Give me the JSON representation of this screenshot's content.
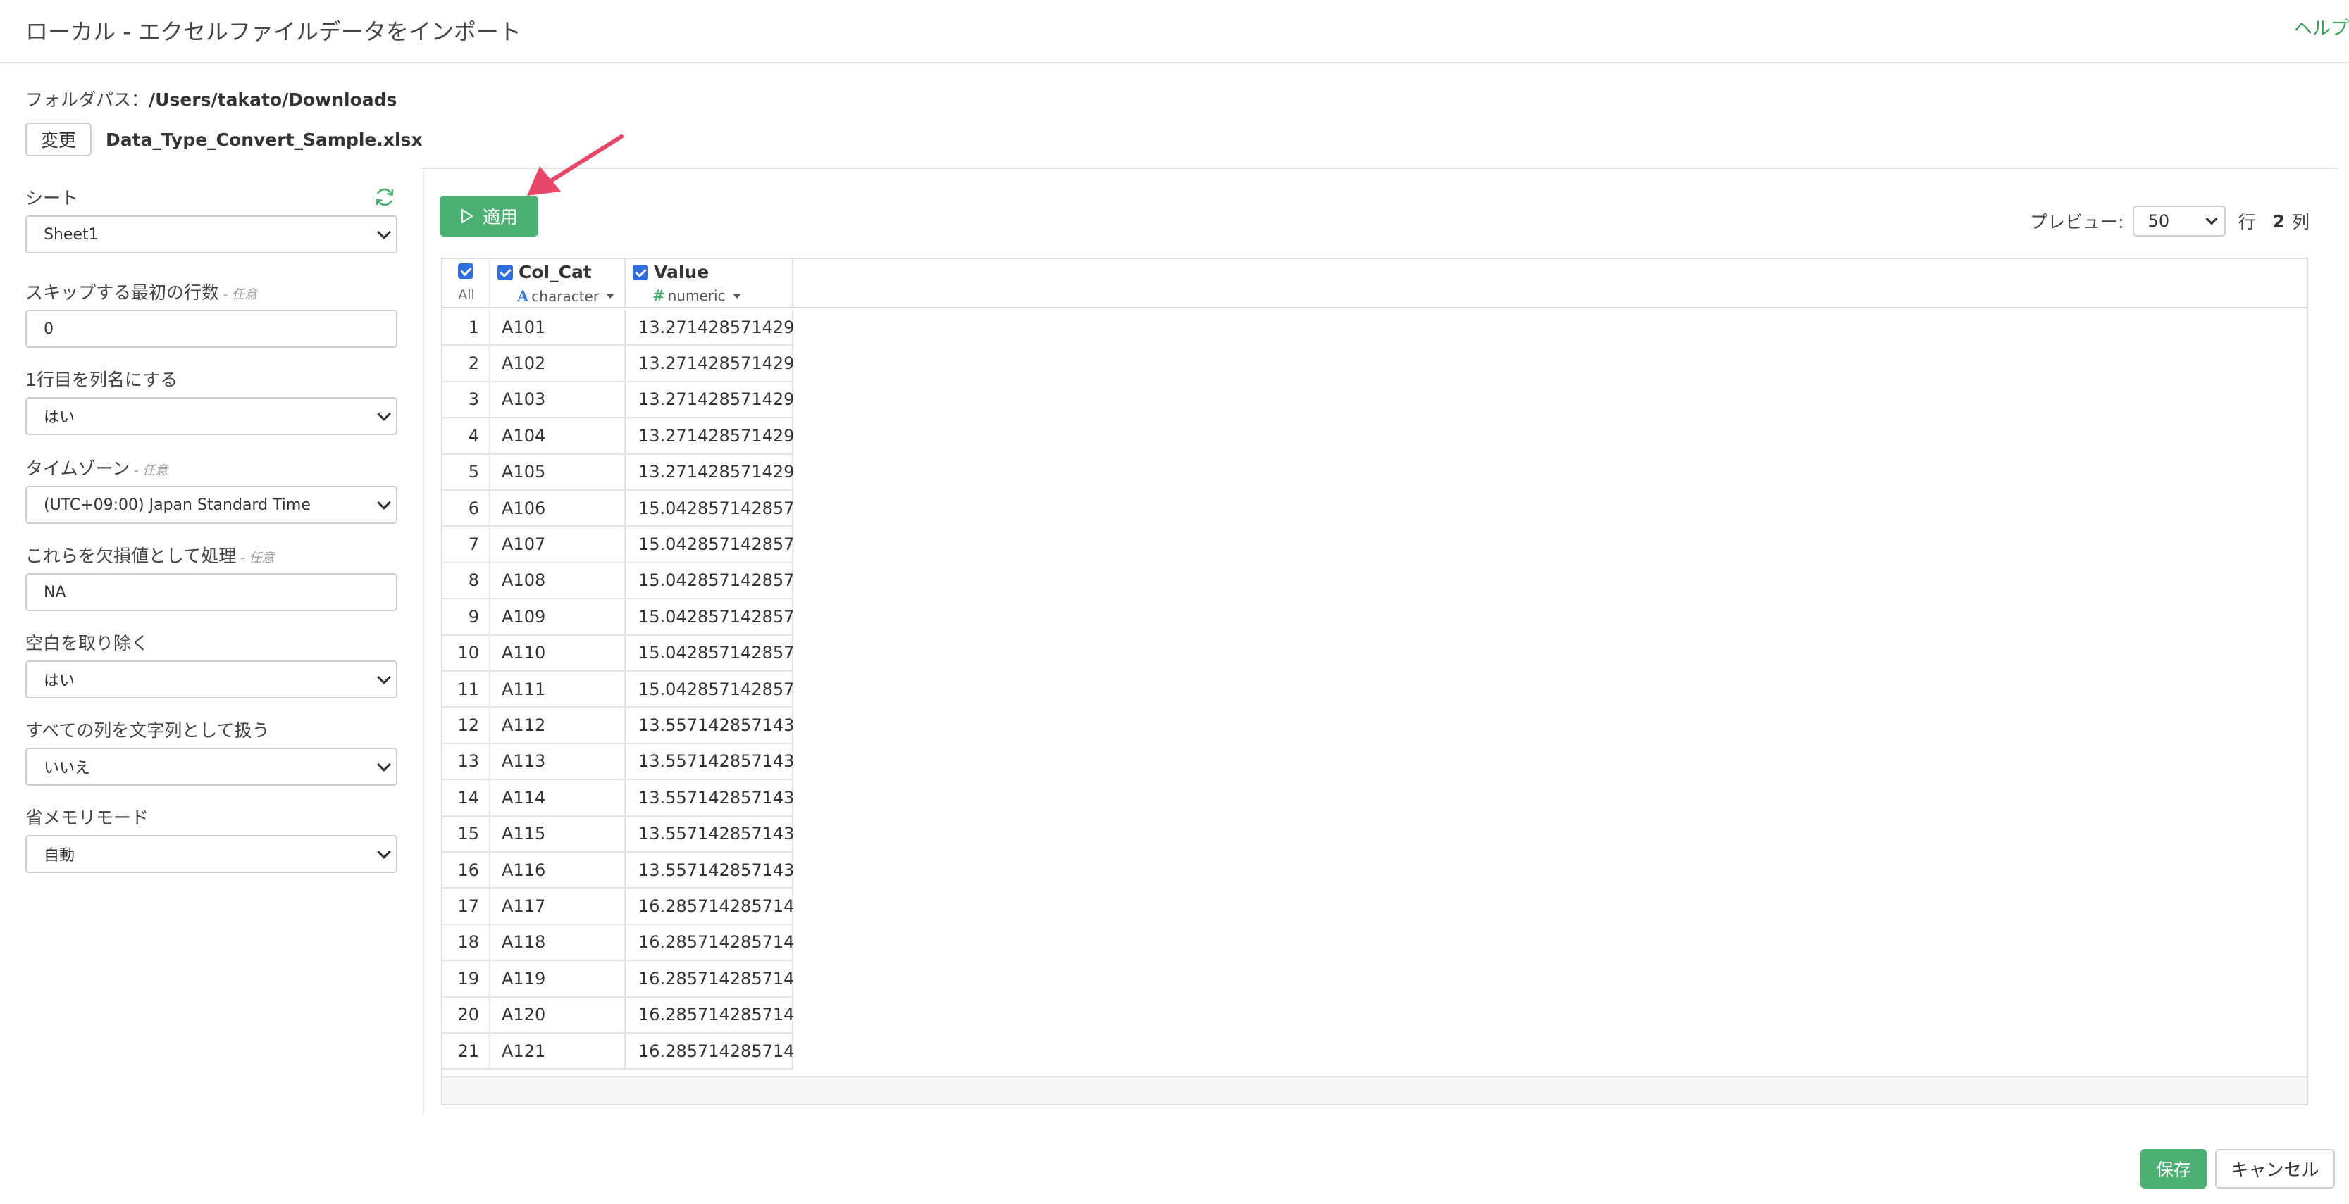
{
  "header": {
    "title": "ローカル - エクセルファイルデータをインポート",
    "help": "ヘルプ"
  },
  "folder": {
    "label": "フォルダパス：",
    "path": "/Users/takato/Downloads"
  },
  "file": {
    "change_button": "変更",
    "name": "Data_Type_Convert_Sample.xlsx"
  },
  "settings": {
    "sheet": {
      "label": "シート",
      "value": "Sheet1"
    },
    "skip_rows": {
      "label": "スキップする最初の行数",
      "optional": " - 任意",
      "value": "0"
    },
    "first_row_header": {
      "label": "1行目を列名にする",
      "value": "はい"
    },
    "timezone": {
      "label": "タイムゾーン",
      "optional": " - 任意",
      "value": "(UTC+09:00) Japan Standard Time"
    },
    "na_values": {
      "label": "これらを欠損値として処理",
      "optional": " - 任意",
      "value": "NA"
    },
    "trim_ws": {
      "label": "空白を取り除く",
      "value": "はい"
    },
    "all_as_char": {
      "label": "すべての列を文字列として扱う",
      "value": "いいえ"
    },
    "memory_saver": {
      "label": "省メモリモード",
      "value": "自動"
    }
  },
  "toolbar": {
    "apply_label": "適用"
  },
  "preview": {
    "label": "プレビュー:",
    "value": "50",
    "rows_unit": "行",
    "col_count": "2",
    "cols_unit": "列"
  },
  "table": {
    "all_label": "All",
    "columns": [
      {
        "name": "Col_Cat",
        "type_icon": "A",
        "type": "character"
      },
      {
        "name": "Value",
        "type_icon": "#",
        "type": "numeric"
      }
    ],
    "rows": [
      [
        "1",
        "A101",
        "13.271428571429"
      ],
      [
        "2",
        "A102",
        "13.271428571429"
      ],
      [
        "3",
        "A103",
        "13.271428571429"
      ],
      [
        "4",
        "A104",
        "13.271428571429"
      ],
      [
        "5",
        "A105",
        "13.271428571429"
      ],
      [
        "6",
        "A106",
        "15.042857142857"
      ],
      [
        "7",
        "A107",
        "15.042857142857"
      ],
      [
        "8",
        "A108",
        "15.042857142857"
      ],
      [
        "9",
        "A109",
        "15.042857142857"
      ],
      [
        "10",
        "A110",
        "15.042857142857"
      ],
      [
        "11",
        "A111",
        "15.042857142857"
      ],
      [
        "12",
        "A112",
        "13.557142857143"
      ],
      [
        "13",
        "A113",
        "13.557142857143"
      ],
      [
        "14",
        "A114",
        "13.557142857143"
      ],
      [
        "15",
        "A115",
        "13.557142857143"
      ],
      [
        "16",
        "A116",
        "13.557142857143"
      ],
      [
        "17",
        "A117",
        "16.285714285714"
      ],
      [
        "18",
        "A118",
        "16.285714285714"
      ],
      [
        "19",
        "A119",
        "16.285714285714"
      ],
      [
        "20",
        "A120",
        "16.285714285714"
      ],
      [
        "21",
        "A121",
        "16.285714285714"
      ]
    ]
  },
  "footer": {
    "save_label": "保存",
    "cancel_label": "キャンセル"
  },
  "colors": {
    "accent_green": "#4caf73",
    "checkbox_blue": "#2f6fdc",
    "annotation_arrow": "#e8476a"
  }
}
